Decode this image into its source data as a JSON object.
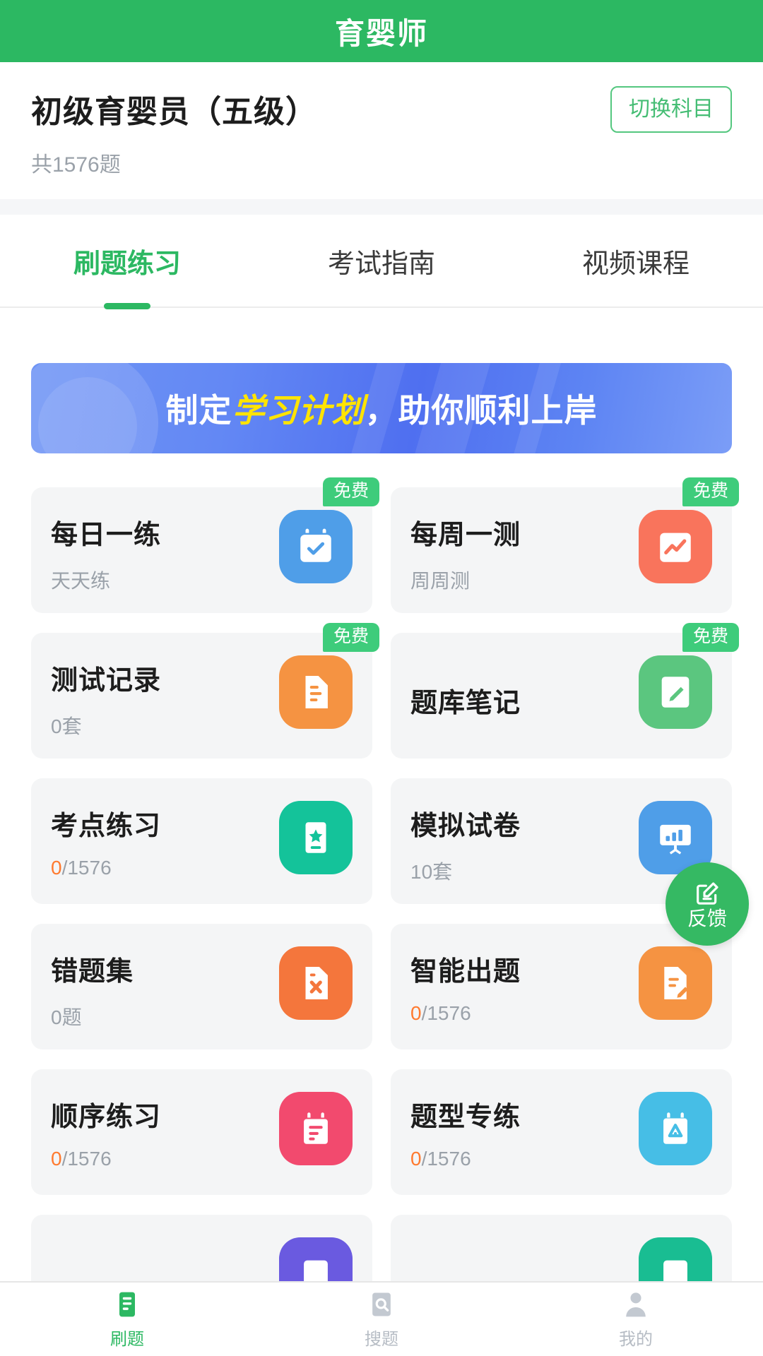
{
  "header": {
    "title": "育婴师"
  },
  "subject": {
    "name": "初级育婴员（五级）",
    "count": "共1576题",
    "switch_label": "切换科目"
  },
  "tabs": [
    {
      "label": "刷题练习",
      "active": true
    },
    {
      "label": "考试指南",
      "active": false
    },
    {
      "label": "视频课程",
      "active": false
    }
  ],
  "banner": {
    "prefix": "制定",
    "highlight": "学习计划",
    "suffix": "，助你顺利上岸",
    "bg_color": "#5676F2",
    "highlight_color": "#FFE400"
  },
  "badge_label": "免费",
  "cards": [
    {
      "title": "每日一练",
      "sub": "天天练",
      "zero": "",
      "badge": true,
      "icon": "calendar-check-icon",
      "color": "#4F9EE8"
    },
    {
      "title": "每周一测",
      "sub": "周周测",
      "zero": "",
      "badge": true,
      "icon": "chart-card-icon",
      "color": "#F9745C"
    },
    {
      "title": "测试记录",
      "sub": "0套",
      "zero": "",
      "badge": true,
      "icon": "document-lines-icon",
      "color": "#F59342"
    },
    {
      "title": "题库笔记",
      "sub": "",
      "zero": "",
      "badge": true,
      "icon": "note-edit-icon",
      "color": "#5BC67F"
    },
    {
      "title": "考点练习",
      "sub": "/1576",
      "zero": "0",
      "badge": false,
      "icon": "star-book-icon",
      "color": "#14C39A"
    },
    {
      "title": "模拟试卷",
      "sub": "10套",
      "zero": "",
      "badge": false,
      "icon": "board-chart-icon",
      "color": "#4F9EE8"
    },
    {
      "title": "错题集",
      "sub": "0题",
      "zero": "",
      "badge": false,
      "icon": "wrong-doc-icon",
      "color": "#F4763C"
    },
    {
      "title": "智能出题",
      "sub": "/1576",
      "zero": "0",
      "badge": false,
      "icon": "smart-doc-icon",
      "color": "#F59342"
    },
    {
      "title": "顺序练习",
      "sub": "/1576",
      "zero": "0",
      "badge": false,
      "icon": "order-calendar-icon",
      "color": "#F24A6E"
    },
    {
      "title": "题型专练",
      "sub": "/1576",
      "zero": "0",
      "badge": false,
      "icon": "type-doc-icon",
      "color": "#46BEE6"
    },
    {
      "title": "",
      "sub": "",
      "zero": "",
      "badge": false,
      "icon": "purple-icon",
      "color": "#6A5AE0"
    },
    {
      "title": "",
      "sub": "",
      "zero": "",
      "badge": false,
      "icon": "teal-icon",
      "color": "#19BD92"
    }
  ],
  "fab": {
    "label": "反馈",
    "color": "#35B963"
  },
  "tabbar": [
    {
      "label": "刷题",
      "icon": "document-icon",
      "active": true
    },
    {
      "label": "搜题",
      "icon": "search-icon",
      "active": false
    },
    {
      "label": "我的",
      "icon": "user-icon",
      "active": false
    }
  ]
}
